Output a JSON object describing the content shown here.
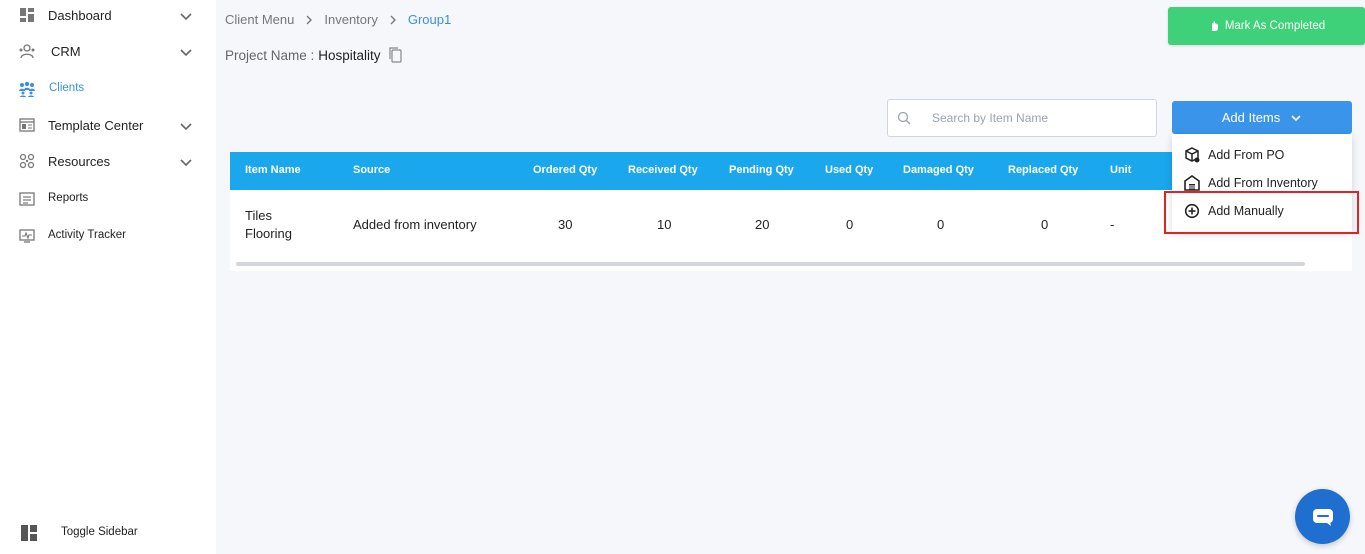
{
  "sidebar": {
    "items": [
      {
        "label": "Dashboard",
        "icon": "dashboard-icon",
        "has_chevron": true
      },
      {
        "label": "CRM",
        "icon": "crm-icon",
        "has_chevron": true
      },
      {
        "label": "Clients",
        "icon": "clients-icon",
        "has_chevron": false,
        "active": true
      },
      {
        "label": "Template Center",
        "icon": "template-icon",
        "has_chevron": true
      },
      {
        "label": "Resources",
        "icon": "resources-icon",
        "has_chevron": true
      },
      {
        "label": "Reports",
        "icon": "reports-icon",
        "has_chevron": false
      },
      {
        "label": "Activity Tracker",
        "icon": "activity-icon",
        "has_chevron": false
      }
    ],
    "toggle_label": "Toggle Sidebar"
  },
  "breadcrumb": [
    "Client Menu",
    "Inventory",
    "Group1"
  ],
  "project": {
    "label": "Project Name :",
    "value": "Hospitality"
  },
  "mark_completed_label": "Mark As Completed",
  "search": {
    "placeholder": "Search by Item Name",
    "value": ""
  },
  "add_items_label": "Add Items",
  "dropdown": [
    {
      "label": "Add From PO",
      "icon": "package-icon"
    },
    {
      "label": "Add From Inventory",
      "icon": "warehouse-icon"
    },
    {
      "label": "Add Manually",
      "icon": "plus-circle-icon"
    }
  ],
  "table": {
    "headers": [
      "Item Name",
      "Source",
      "Ordered Qty",
      "Received Qty",
      "Pending Qty",
      "Used Qty",
      "Damaged Qty",
      "Replaced Qty",
      "Unit"
    ],
    "rows": [
      {
        "item_line1": "Tiles",
        "item_line2": "Flooring",
        "source": "Added from inventory",
        "ordered": "30",
        "received": "10",
        "pending": "20",
        "used": "0",
        "damaged": "0",
        "replaced": "0",
        "unit": "-"
      }
    ]
  },
  "colors": {
    "accent": "#3a95ea",
    "table_header": "#1aa7ec",
    "success": "#3ed17a",
    "highlight": "#e02424",
    "chat": "#1f6fd1"
  }
}
